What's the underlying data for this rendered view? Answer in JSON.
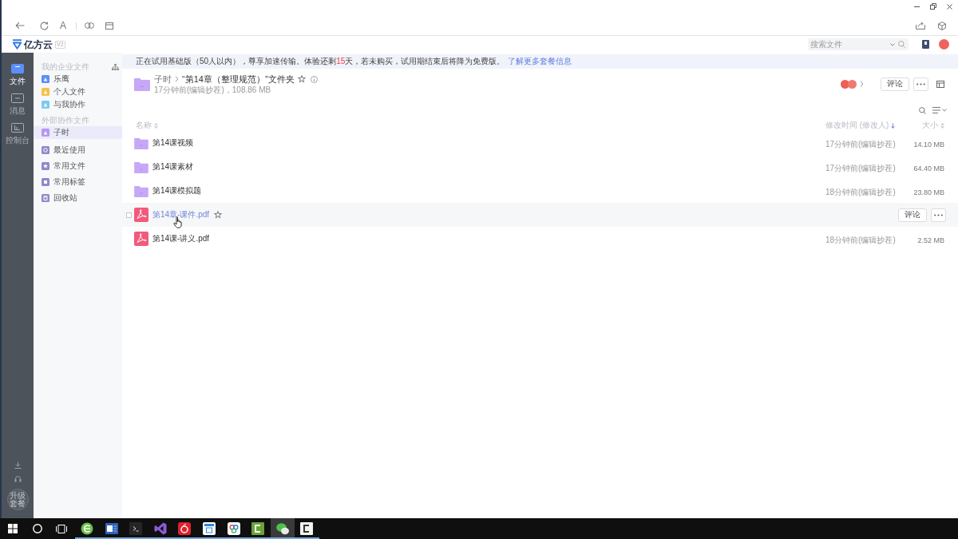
{
  "browser_toolbar": {
    "font_button": "A"
  },
  "app_header": {
    "logo_text": "亿方云",
    "version_badge": "V2",
    "search": {
      "placeholder": "搜索文件"
    }
  },
  "nav": {
    "items": [
      {
        "kind": "files",
        "label": "文件",
        "selected": true
      },
      {
        "kind": "messages",
        "label": "消息",
        "selected": false
      },
      {
        "kind": "console",
        "label": "控制台",
        "selected": false
      }
    ],
    "upgrade_button": "升级套餐"
  },
  "sidebar": {
    "sections": [
      {
        "title": "我的企业文件",
        "items": [
          {
            "label": "乐鹰",
            "color": "#5b8ff9",
            "selected": false
          },
          {
            "label": "个人文件",
            "color": "#f6c04a",
            "selected": false
          },
          {
            "label": "与我协作",
            "color": "#7ccaf2",
            "selected": false
          }
        ]
      },
      {
        "title": "外部协作文件",
        "items": [
          {
            "label": "子时",
            "color": "#b797f2",
            "selected": true
          }
        ]
      }
    ],
    "shortcuts": [
      {
        "kind": "recent",
        "label": "最近使用"
      },
      {
        "kind": "starred",
        "label": "常用文件"
      },
      {
        "kind": "tags",
        "label": "常用标签"
      },
      {
        "kind": "trash",
        "label": "回收站"
      }
    ]
  },
  "banner": {
    "parts": [
      {
        "kind": "plain",
        "text": "正在试用基础版（50人以内），尊享加速传输。体验还剩"
      },
      {
        "kind": "highlight",
        "text": "15"
      },
      {
        "kind": "plain",
        "text": "天，若未购买，试用期结束后将降为免费版。"
      }
    ],
    "link": "了解更多套餐信息"
  },
  "folder": {
    "breadcrumb": "子时",
    "title": "“第14章（整理规范）”文件夹",
    "starred": false,
    "meta": "17分钟前(编辑抄茬)，108.86 MB",
    "comment_button": "评论"
  },
  "table": {
    "columns": [
      {
        "label": "名称",
        "sorted": false
      },
      {
        "label": "修改时间 (修改人)",
        "sorted": true
      },
      {
        "label": "大小",
        "sorted": false
      }
    ],
    "rows": [
      {
        "kind": "folder",
        "name": "第14课视频",
        "modified": "17分钟前(编辑抄茬)",
        "size": "14.10 MB",
        "hovered": false
      },
      {
        "kind": "folder",
        "name": "第14课素材",
        "modified": "17分钟前(编辑抄茬)",
        "size": "64.40 MB",
        "hovered": false
      },
      {
        "kind": "folder",
        "name": "第14课模拟题",
        "modified": "18分钟前(编辑抄茬)",
        "size": "23.80 MB",
        "hovered": false
      },
      {
        "kind": "pdf",
        "name": "第14章-课件.pdf",
        "hovered": true,
        "checked": false,
        "starred": false,
        "comment_button": "评论"
      },
      {
        "kind": "pdf",
        "name": "第14课-讲义.pdf",
        "modified": "18分钟前(编辑抄茬)",
        "size": "2.52 MB",
        "hovered": false
      }
    ]
  },
  "taskbar": {
    "apps": [
      {
        "kind": "browser",
        "selected": false,
        "running": true
      },
      {
        "kind": "word",
        "selected": false,
        "running": true
      },
      {
        "kind": "terminal",
        "selected": false,
        "running": true
      },
      {
        "kind": "ide",
        "selected": false,
        "running": true
      },
      {
        "kind": "music",
        "selected": false,
        "running": true
      },
      {
        "kind": "calendar",
        "selected": false,
        "running": true
      },
      {
        "kind": "cloud",
        "selected": false,
        "running": true
      },
      {
        "kind": "recorder",
        "selected": false,
        "running": true
      },
      {
        "kind": "chat",
        "selected": true,
        "running": true
      },
      {
        "kind": "editor",
        "selected": false,
        "running": true
      }
    ]
  }
}
